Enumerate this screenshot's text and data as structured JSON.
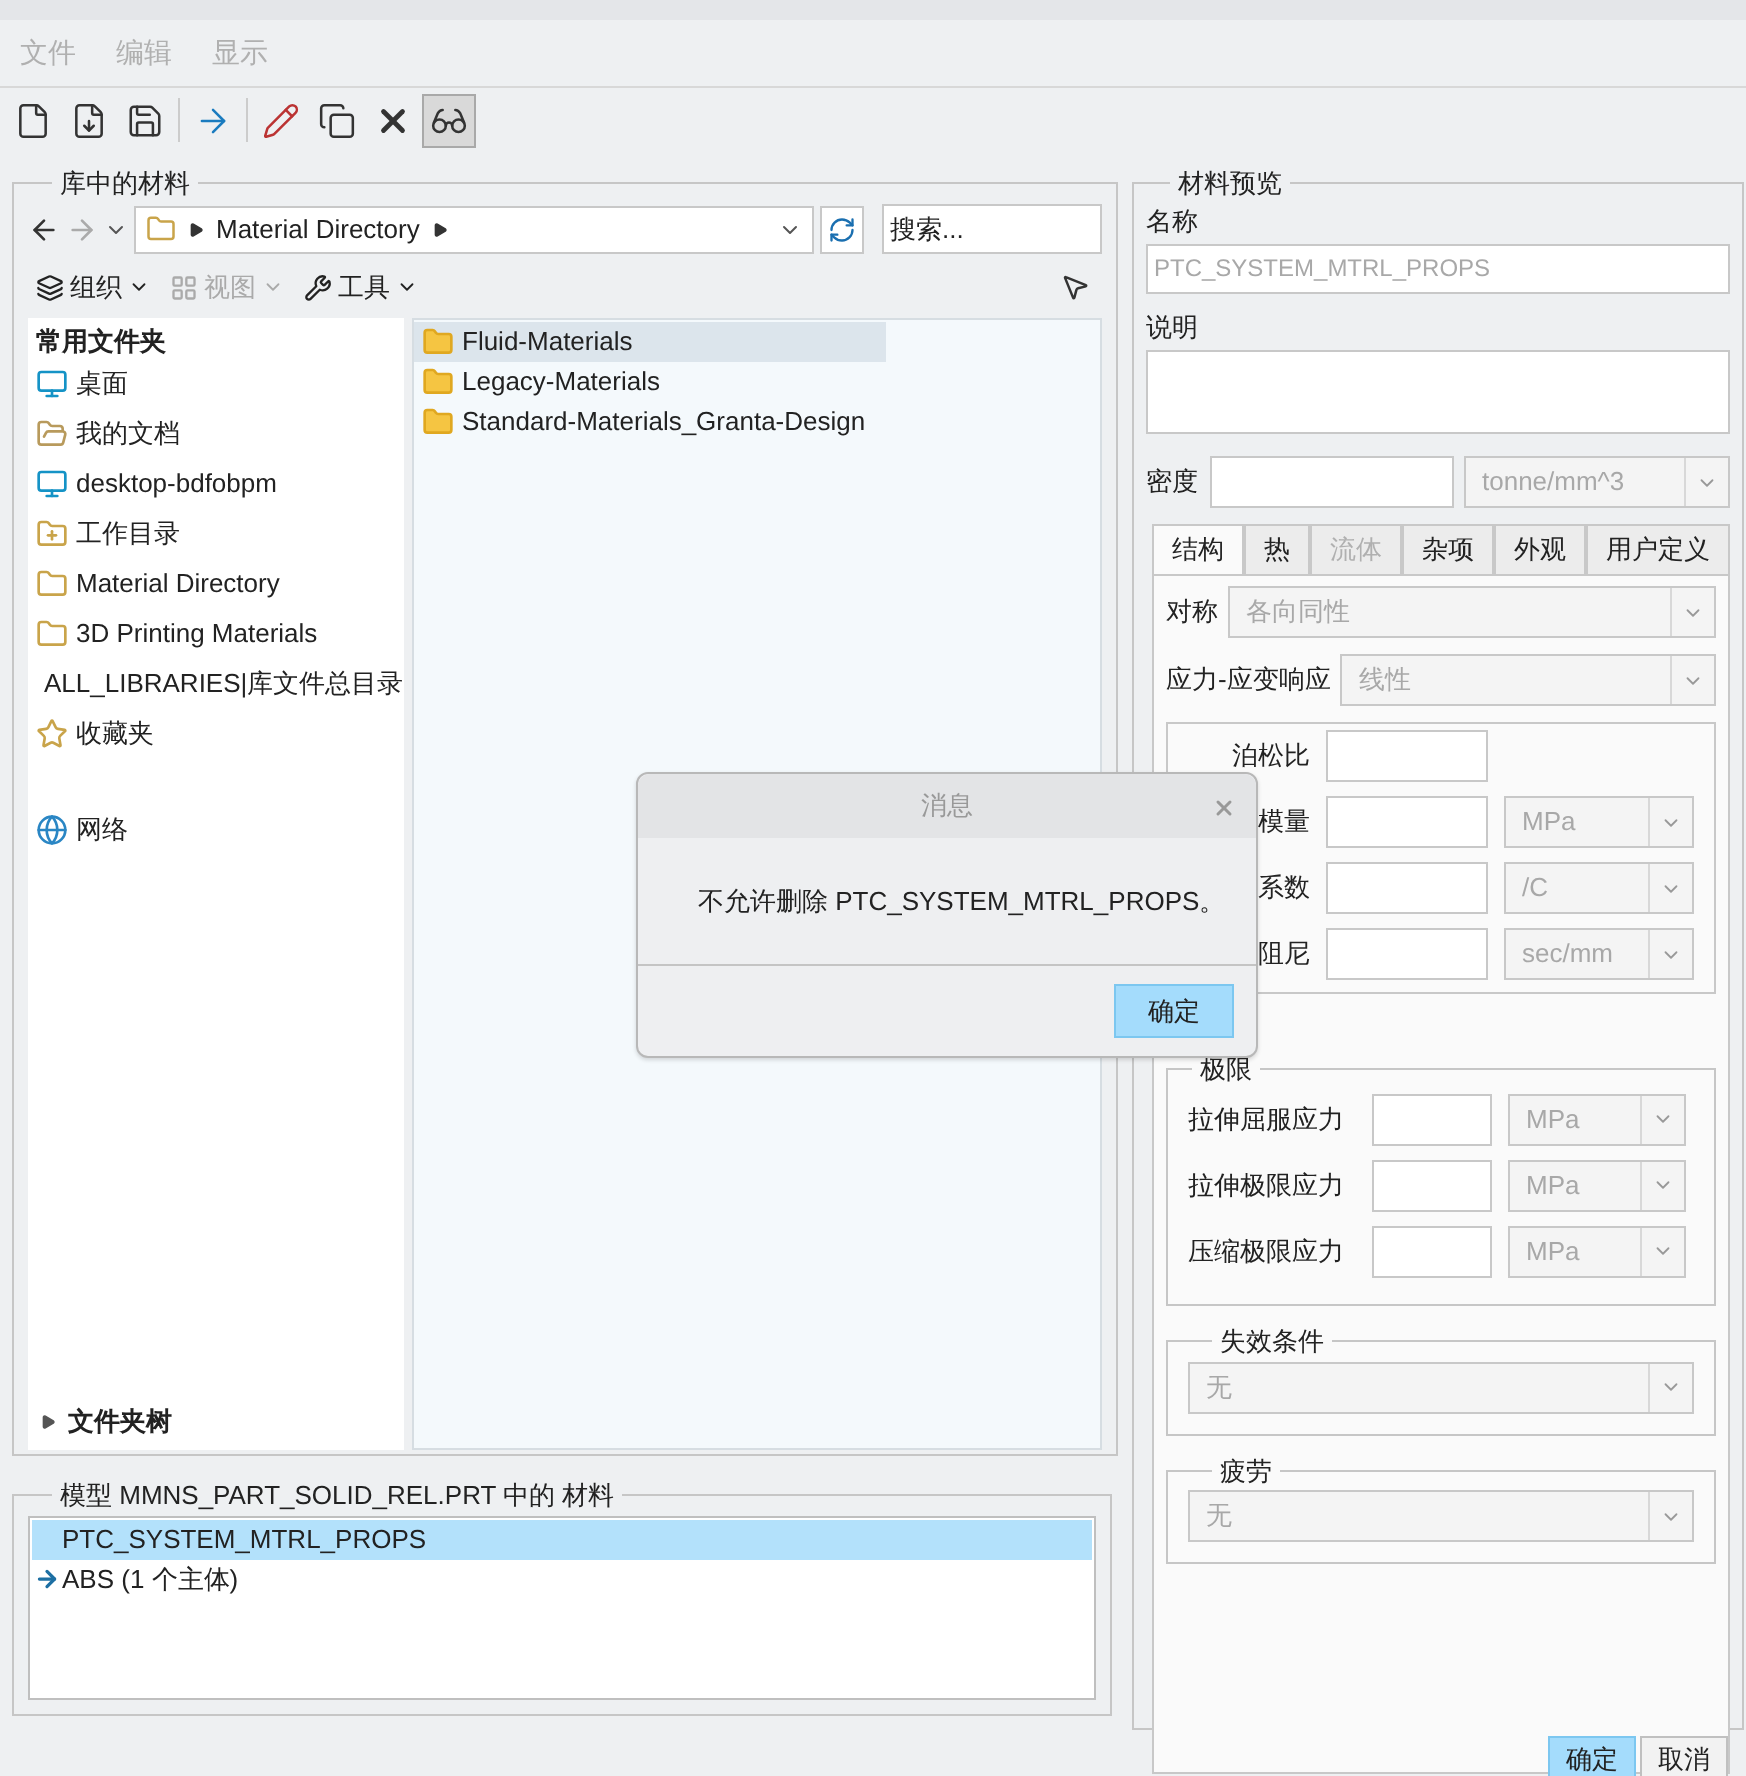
{
  "menu": [
    {
      "label": "文件",
      "disabled": true
    },
    {
      "label": "编辑",
      "disabled": true
    },
    {
      "label": "显示",
      "disabled": true
    }
  ],
  "toolbar": [
    {
      "kind": "new",
      "selected": false
    },
    {
      "kind": "new-fluid",
      "selected": false
    },
    {
      "kind": "save",
      "selected": false
    },
    {
      "kind": "assign",
      "selected": false
    },
    {
      "kind": "edit",
      "selected": false
    },
    {
      "kind": "copy",
      "selected": false
    },
    {
      "kind": "delete",
      "selected": false
    },
    {
      "kind": "preview",
      "selected": true
    }
  ],
  "library": {
    "title": "库中的材料",
    "path": [
      "Material Directory"
    ],
    "search": {
      "placeholder": "搜索..."
    },
    "tools": [
      {
        "label": "组织",
        "disabled": false
      },
      {
        "label": "视图",
        "disabled": true
      },
      {
        "label": "工具",
        "disabled": false
      }
    ],
    "favorites_title": "常用文件夹",
    "favorites": [
      {
        "kind": "desktop",
        "label": "桌面"
      },
      {
        "kind": "documents",
        "label": "我的文档"
      },
      {
        "kind": "computer",
        "label": "desktop-bdfobpm"
      },
      {
        "kind": "workdir",
        "label": "工作目录"
      },
      {
        "kind": "library",
        "label": "Material Directory"
      },
      {
        "kind": "library",
        "label": "3D Printing Materials"
      },
      {
        "kind": "libraries",
        "label": "ALL_LIBRARIES|库文件总目录"
      },
      {
        "kind": "favorites",
        "label": "收藏夹"
      },
      {
        "kind": "gap"
      },
      {
        "kind": "network",
        "label": "网络"
      }
    ],
    "folder_tree": {
      "label": "文件夹树",
      "expanded": false
    },
    "files": [
      {
        "label": "Fluid-Materials",
        "selected": true
      },
      {
        "label": "Legacy-Materials",
        "selected": false
      },
      {
        "label": "Standard-Materials_Granta-Design",
        "selected": false
      }
    ]
  },
  "model": {
    "title": "模型 MMNS_PART_SOLID_REL.PRT 中的 材料",
    "items": [
      {
        "label": "PTC_SYSTEM_MTRL_PROPS",
        "selected": true,
        "assigned": false
      },
      {
        "label": "ABS (1 个主体)",
        "selected": false,
        "assigned": true
      }
    ]
  },
  "preview": {
    "title": "材料预览",
    "name_label": "名称",
    "name": "PTC_SYSTEM_MTRL_PROPS",
    "description_label": "说明",
    "density_label": "密度",
    "density_unit": {
      "value": "tonne/mm^3",
      "disabled": true
    },
    "tabs": [
      {
        "label": "结构",
        "selected": true,
        "disabled": false
      },
      {
        "label": "热",
        "selected": false,
        "disabled": false
      },
      {
        "label": "流体",
        "selected": false,
        "disabled": true
      },
      {
        "label": "杂项",
        "selected": false,
        "disabled": false
      },
      {
        "label": "外观",
        "selected": false,
        "disabled": false
      },
      {
        "label": "用户定义",
        "selected": false,
        "disabled": false
      }
    ],
    "symmetry": {
      "label": "对称",
      "value": "各向同性",
      "disabled": true
    },
    "response": {
      "label": "应力-应变响应",
      "value": "线性",
      "disabled": true
    },
    "properties": [
      {
        "label": "泊松比"
      },
      {
        "label": "模量",
        "unit": {
          "value": "MPa",
          "disabled": true
        }
      },
      {
        "label": "系数",
        "unit": {
          "value": "/C",
          "disabled": true
        }
      },
      {
        "label": "阻尼",
        "unit": {
          "value": "sec/mm",
          "disabled": true
        }
      }
    ],
    "limits": {
      "title": "极限",
      "rows": [
        {
          "label": "拉伸屈服应力",
          "unit": {
            "value": "MPa",
            "disabled": true
          }
        },
        {
          "label": "拉伸极限应力",
          "unit": {
            "value": "MPa",
            "disabled": true
          }
        },
        {
          "label": "压缩极限应力",
          "unit": {
            "value": "MPa",
            "disabled": true
          }
        }
      ]
    },
    "failure": {
      "title": "失效条件",
      "value": "无",
      "disabled": true
    },
    "fatigue": {
      "title": "疲劳",
      "value": "无",
      "disabled": true
    }
  },
  "buttons": [
    {
      "label": "确定",
      "selected": true
    },
    {
      "label": "取消",
      "selected": false
    }
  ],
  "dialog": {
    "title": "消息",
    "message": "不允许删除 PTC_SYSTEM_MTRL_PROPS。",
    "button": "确定"
  }
}
